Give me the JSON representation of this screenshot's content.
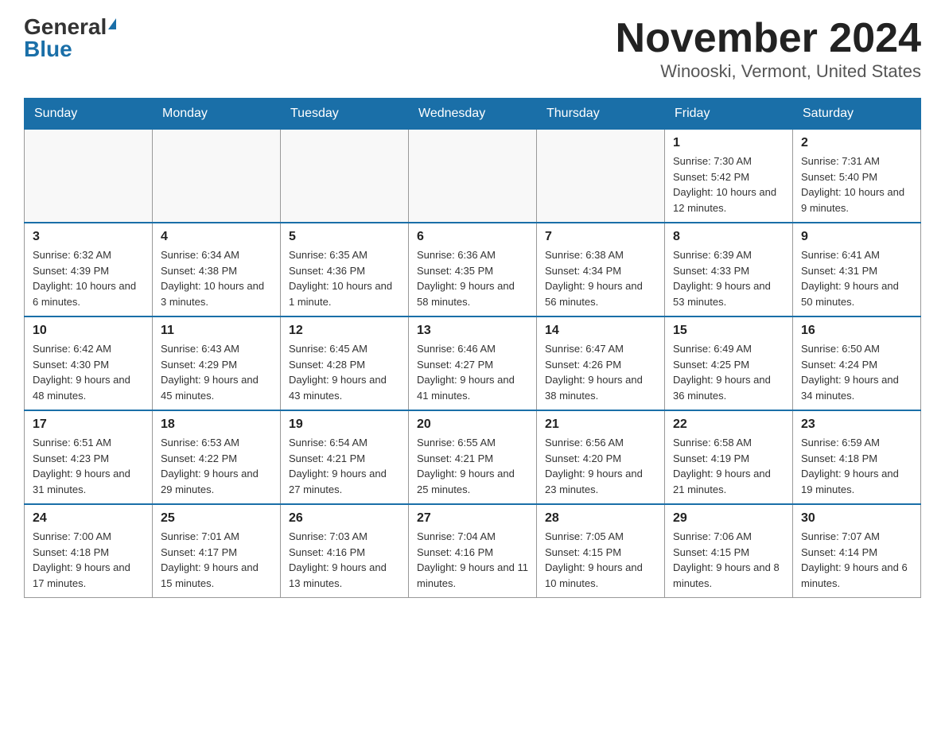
{
  "header": {
    "logo_general": "General",
    "logo_blue": "Blue",
    "title": "November 2024",
    "subtitle": "Winooski, Vermont, United States"
  },
  "weekdays": [
    "Sunday",
    "Monday",
    "Tuesday",
    "Wednesday",
    "Thursday",
    "Friday",
    "Saturday"
  ],
  "weeks": [
    [
      {
        "day": "",
        "info": ""
      },
      {
        "day": "",
        "info": ""
      },
      {
        "day": "",
        "info": ""
      },
      {
        "day": "",
        "info": ""
      },
      {
        "day": "",
        "info": ""
      },
      {
        "day": "1",
        "info": "Sunrise: 7:30 AM\nSunset: 5:42 PM\nDaylight: 10 hours and 12 minutes."
      },
      {
        "day": "2",
        "info": "Sunrise: 7:31 AM\nSunset: 5:40 PM\nDaylight: 10 hours and 9 minutes."
      }
    ],
    [
      {
        "day": "3",
        "info": "Sunrise: 6:32 AM\nSunset: 4:39 PM\nDaylight: 10 hours and 6 minutes."
      },
      {
        "day": "4",
        "info": "Sunrise: 6:34 AM\nSunset: 4:38 PM\nDaylight: 10 hours and 3 minutes."
      },
      {
        "day": "5",
        "info": "Sunrise: 6:35 AM\nSunset: 4:36 PM\nDaylight: 10 hours and 1 minute."
      },
      {
        "day": "6",
        "info": "Sunrise: 6:36 AM\nSunset: 4:35 PM\nDaylight: 9 hours and 58 minutes."
      },
      {
        "day": "7",
        "info": "Sunrise: 6:38 AM\nSunset: 4:34 PM\nDaylight: 9 hours and 56 minutes."
      },
      {
        "day": "8",
        "info": "Sunrise: 6:39 AM\nSunset: 4:33 PM\nDaylight: 9 hours and 53 minutes."
      },
      {
        "day": "9",
        "info": "Sunrise: 6:41 AM\nSunset: 4:31 PM\nDaylight: 9 hours and 50 minutes."
      }
    ],
    [
      {
        "day": "10",
        "info": "Sunrise: 6:42 AM\nSunset: 4:30 PM\nDaylight: 9 hours and 48 minutes."
      },
      {
        "day": "11",
        "info": "Sunrise: 6:43 AM\nSunset: 4:29 PM\nDaylight: 9 hours and 45 minutes."
      },
      {
        "day": "12",
        "info": "Sunrise: 6:45 AM\nSunset: 4:28 PM\nDaylight: 9 hours and 43 minutes."
      },
      {
        "day": "13",
        "info": "Sunrise: 6:46 AM\nSunset: 4:27 PM\nDaylight: 9 hours and 41 minutes."
      },
      {
        "day": "14",
        "info": "Sunrise: 6:47 AM\nSunset: 4:26 PM\nDaylight: 9 hours and 38 minutes."
      },
      {
        "day": "15",
        "info": "Sunrise: 6:49 AM\nSunset: 4:25 PM\nDaylight: 9 hours and 36 minutes."
      },
      {
        "day": "16",
        "info": "Sunrise: 6:50 AM\nSunset: 4:24 PM\nDaylight: 9 hours and 34 minutes."
      }
    ],
    [
      {
        "day": "17",
        "info": "Sunrise: 6:51 AM\nSunset: 4:23 PM\nDaylight: 9 hours and 31 minutes."
      },
      {
        "day": "18",
        "info": "Sunrise: 6:53 AM\nSunset: 4:22 PM\nDaylight: 9 hours and 29 minutes."
      },
      {
        "day": "19",
        "info": "Sunrise: 6:54 AM\nSunset: 4:21 PM\nDaylight: 9 hours and 27 minutes."
      },
      {
        "day": "20",
        "info": "Sunrise: 6:55 AM\nSunset: 4:21 PM\nDaylight: 9 hours and 25 minutes."
      },
      {
        "day": "21",
        "info": "Sunrise: 6:56 AM\nSunset: 4:20 PM\nDaylight: 9 hours and 23 minutes."
      },
      {
        "day": "22",
        "info": "Sunrise: 6:58 AM\nSunset: 4:19 PM\nDaylight: 9 hours and 21 minutes."
      },
      {
        "day": "23",
        "info": "Sunrise: 6:59 AM\nSunset: 4:18 PM\nDaylight: 9 hours and 19 minutes."
      }
    ],
    [
      {
        "day": "24",
        "info": "Sunrise: 7:00 AM\nSunset: 4:18 PM\nDaylight: 9 hours and 17 minutes."
      },
      {
        "day": "25",
        "info": "Sunrise: 7:01 AM\nSunset: 4:17 PM\nDaylight: 9 hours and 15 minutes."
      },
      {
        "day": "26",
        "info": "Sunrise: 7:03 AM\nSunset: 4:16 PM\nDaylight: 9 hours and 13 minutes."
      },
      {
        "day": "27",
        "info": "Sunrise: 7:04 AM\nSunset: 4:16 PM\nDaylight: 9 hours and 11 minutes."
      },
      {
        "day": "28",
        "info": "Sunrise: 7:05 AM\nSunset: 4:15 PM\nDaylight: 9 hours and 10 minutes."
      },
      {
        "day": "29",
        "info": "Sunrise: 7:06 AM\nSunset: 4:15 PM\nDaylight: 9 hours and 8 minutes."
      },
      {
        "day": "30",
        "info": "Sunrise: 7:07 AM\nSunset: 4:14 PM\nDaylight: 9 hours and 6 minutes."
      }
    ]
  ]
}
